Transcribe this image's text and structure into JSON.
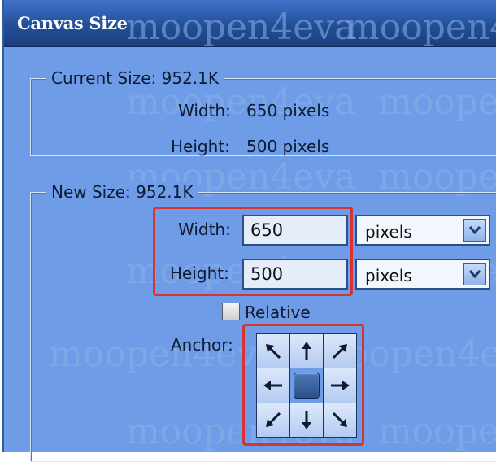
{
  "dialog": {
    "title": "Canvas Size",
    "current_size": {
      "legend": "Current Size: 952.1K",
      "width_label": "Width:",
      "width_value": "650 pixels",
      "height_label": "Height:",
      "height_value": "500 pixels"
    },
    "new_size": {
      "legend": "New Size: 952.1K",
      "width_label": "Width:",
      "width_value": "650",
      "width_unit": "pixels",
      "height_label": "Height:",
      "height_value": "500",
      "height_unit": "pixels",
      "relative_label": "Relative",
      "relative_checked": false,
      "anchor_label": "Anchor:",
      "anchor_selected": "center"
    }
  },
  "watermark": "moopen4eva",
  "colors": {
    "dialog_bg": "#6e9ce6",
    "title_bar": "#234f99",
    "highlight": "#d93232"
  }
}
